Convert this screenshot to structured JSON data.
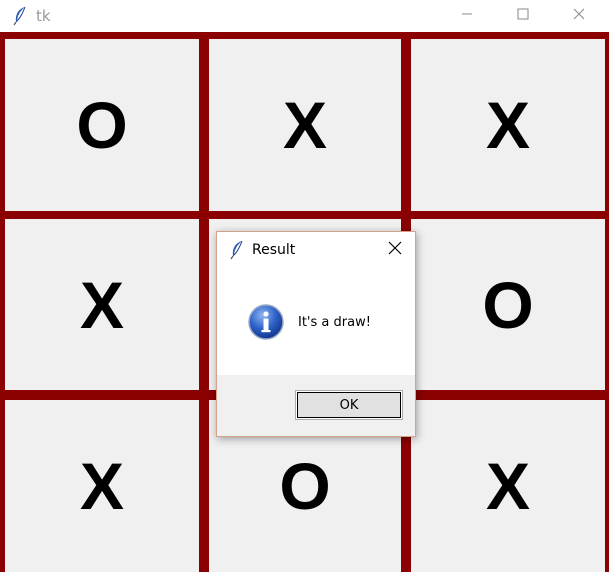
{
  "window": {
    "title": "tk",
    "icons": {
      "app": "feather-icon",
      "minimize": "minimize-icon",
      "maximize": "maximize-icon",
      "close": "close-icon"
    }
  },
  "board": {
    "colors": {
      "grid": "#8b0000",
      "cell": "#f0f0f0",
      "mark": "#000000"
    },
    "cells": [
      "O",
      "X",
      "X",
      "X",
      "",
      "O",
      "X",
      "O",
      "X"
    ]
  },
  "dialog": {
    "title": "Result",
    "message": "It's a draw!",
    "ok_label": "OK",
    "icons": {
      "title": "feather-icon",
      "message": "info-icon",
      "close": "close-icon"
    }
  }
}
